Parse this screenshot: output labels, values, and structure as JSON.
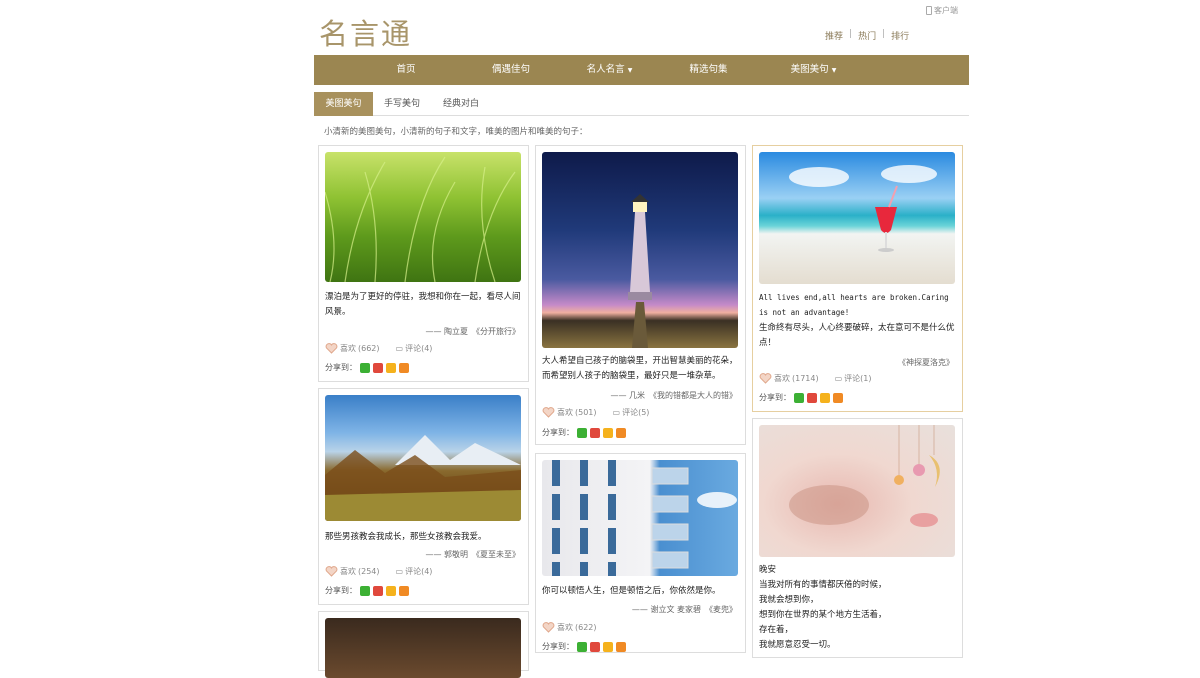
{
  "header": {
    "logo": "名言通",
    "client": "客户端",
    "links": [
      "推荐",
      "热门",
      "排行"
    ]
  },
  "nav": [
    "首页",
    "偶遇佳句",
    "名人名言",
    "精选句集",
    "美图美句"
  ],
  "tabs": [
    "美图美句",
    "手写美句",
    "经典对白"
  ],
  "desc": "小清新的美图美句，小清新的句子和文字，唯美的图片和唯美的句子：",
  "share_label": "分享到：",
  "like_label": "喜欢",
  "cards": [
    {
      "text": "漂泊是为了更好的停驻，我想和你在一起，看尽人间风景。",
      "source": "—— 陶立夏　《分开旅行》",
      "likes": "(662)",
      "comments": "评论(4)"
    },
    {
      "text": "那些男孩教会我成长，那些女孩教会我爱。",
      "source": "—— 郭敬明　《夏至未至》",
      "likes": "(254)",
      "comments": "评论(4)"
    },
    {
      "text": "大人希望自己孩子的脑袋里，开出智慧美丽的花朵，而希望别人孩子的脑袋里，最好只是一堆杂草。",
      "source": "—— 几米　《我的错都是大人的错》",
      "likes": "(501)",
      "comments": "评论(5)"
    },
    {
      "text": "你可以顿悟人生，但是顿悟之后，你依然是你。",
      "source": "—— 谢立文 麦家碧　《麦兜》",
      "likes": "(622)",
      "comments": ""
    },
    {
      "text_en": "All lives end,all hearts are broken.Caring is not an advantage!",
      "text": "生命终有尽头，人心终要破碎，太在意可不是什么优点！",
      "source": "《神探夏洛克》",
      "likes": "(1714)",
      "comments": "评论(1)"
    },
    {
      "lines": [
        "晚安",
        "当我对所有的事情都厌倦的时候，",
        "我就会想到你，",
        "想到你在世界的某个地方生活着，",
        "存在着，",
        "我就愿意忍受一切。"
      ]
    }
  ]
}
